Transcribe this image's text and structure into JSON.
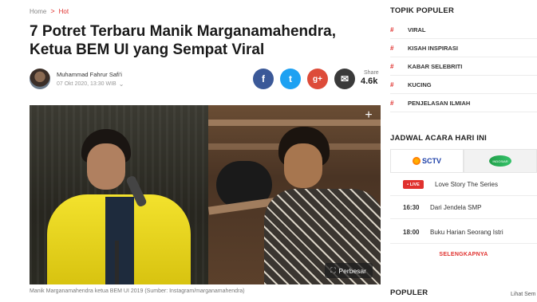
{
  "breadcrumb": {
    "home": "Home",
    "separator": ">",
    "current": "Hot"
  },
  "article": {
    "title": "7 Potret Terbaru Manik Marganamahendra, Ketua BEM UI yang Sempat Viral",
    "author": "Muhammad Fahrur Safi'i",
    "date": "07 Okt 2020, 13:30 WIB",
    "caption": "Manik Marganamahendra ketua BEM UI 2019 (Sumber: Instagram/marganamahendra)",
    "enlarge_label": "Perbesar",
    "plus_label": "+"
  },
  "share": {
    "label": "Share",
    "count": "4.6k",
    "facebook_glyph": "f",
    "twitter_glyph": "t",
    "google_glyph": "g+",
    "email_glyph": "✉"
  },
  "topik_populer": {
    "title": "TOPIK POPULER",
    "hash": "#",
    "items": [
      "VIRAL",
      "KISAH INSPIRASI",
      "KABAR SELEBRITI",
      "KUCING",
      "PENJELASAN ILMIAH"
    ]
  },
  "jadwal": {
    "title": "JADWAL ACARA HARI INI",
    "channels": [
      "SCTV",
      "INDOSIAR"
    ],
    "live_label": "• LIVE",
    "rows": [
      {
        "time": "",
        "program": "Love Story The Series",
        "live": true
      },
      {
        "time": "16:30",
        "program": "Dari Jendela SMP",
        "live": false
      },
      {
        "time": "18:00",
        "program": "Buku Harian Seorang Istri",
        "live": false
      }
    ],
    "see_more": "SELENGKAPNYA"
  },
  "populer": {
    "title": "POPULER",
    "see_all": "Lihat Sem"
  },
  "icons": {
    "chevron": "chevron-down-icon",
    "enlarge": "expand-icon"
  }
}
